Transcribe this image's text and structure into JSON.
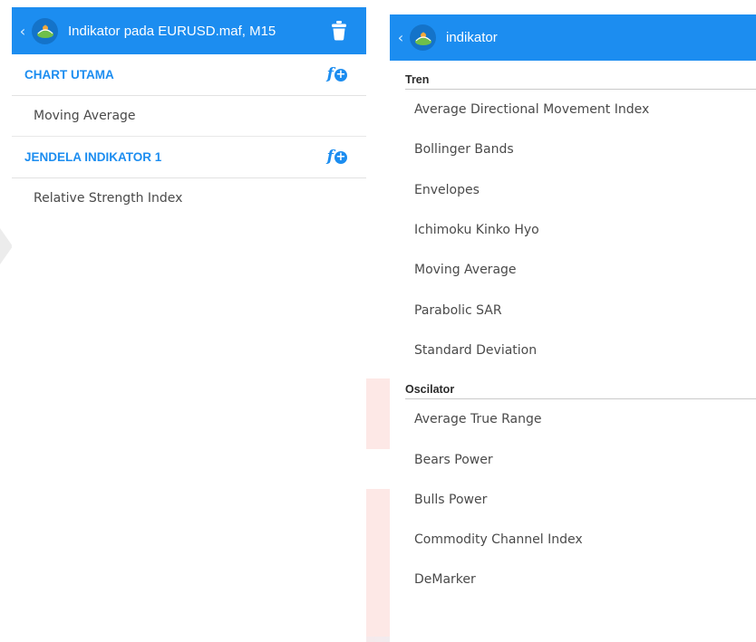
{
  "left": {
    "appbar": {
      "back_icon": "chevron-left-icon",
      "logo_icon": "app-logo-icon",
      "title": "Indikator pada EURUSD.maf, M15",
      "action_icon": "trash-icon"
    },
    "sections": [
      {
        "title": "CHART UTAMA",
        "add_icon": "add-function-icon",
        "items": [
          "Moving Average"
        ]
      },
      {
        "title": "JENDELA INDIKATOR 1",
        "add_icon": "add-function-icon",
        "items": [
          "Relative Strength Index"
        ]
      }
    ]
  },
  "right": {
    "appbar": {
      "back_icon": "chevron-left-icon",
      "logo_icon": "app-logo-icon",
      "title": "indikator"
    },
    "groups": [
      {
        "title": "Tren",
        "items": [
          "Average Directional Movement Index",
          "Bollinger Bands",
          "Envelopes",
          "Ichimoku Kinko Hyo",
          "Moving Average",
          "Parabolic SAR",
          "Standard Deviation"
        ]
      },
      {
        "title": "Oscilator",
        "items": [
          "Average True Range",
          "Bears Power",
          "Bulls Power",
          "Commodity Channel Index",
          "DeMarker"
        ]
      }
    ]
  },
  "colors": {
    "accent": "#1c8df0",
    "text": "#4a4a4a",
    "group_header": "#2b2b2b"
  }
}
